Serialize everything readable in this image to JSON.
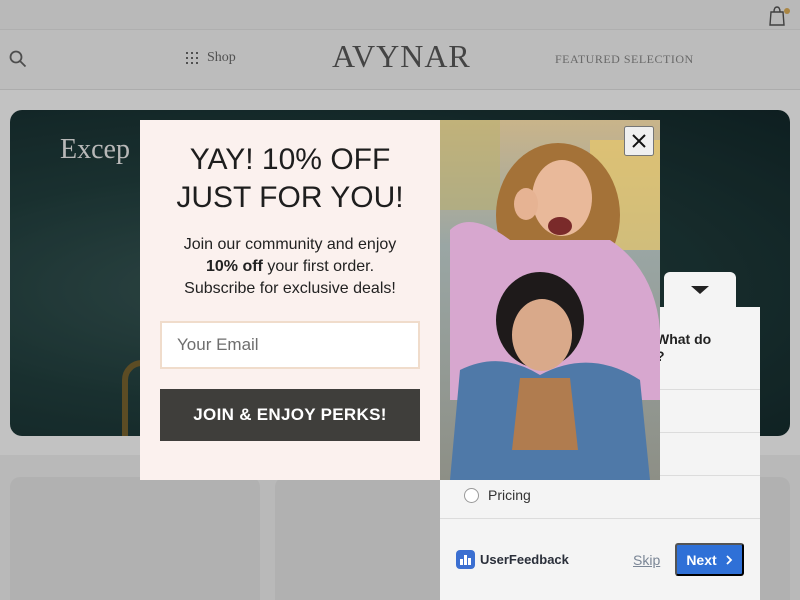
{
  "store": {
    "logo": "AVYNAR",
    "nav": {
      "shop_label": "Shop",
      "featured_label": "FEATURED SELECTION"
    },
    "hero": {
      "title": "Excep"
    }
  },
  "popup": {
    "headline_line1": "YAY! 10% OFF",
    "headline_line2": "JUST FOR YOU!",
    "body_line1": "Join our community and enjoy",
    "body_bold": "10% off",
    "body_line2_rest": " your first order.",
    "body_line3": "Subscribe for exclusive deals!",
    "email_placeholder": "Your Email",
    "cta_label": "JOIN & ENJOY PERKS!",
    "image_icon": "couple-photo"
  },
  "feedback": {
    "question_part1": "What do",
    "question_part2": "?",
    "visible_option": "Pricing",
    "brand_name": "UserFeedback",
    "skip_label": "Skip",
    "next_label": "Next",
    "accent_color": "#2f70d7"
  },
  "colors": {
    "modal_background": "#fbf1ee",
    "cta_background": "#3f3e3b",
    "input_border": "#f0dccb"
  }
}
